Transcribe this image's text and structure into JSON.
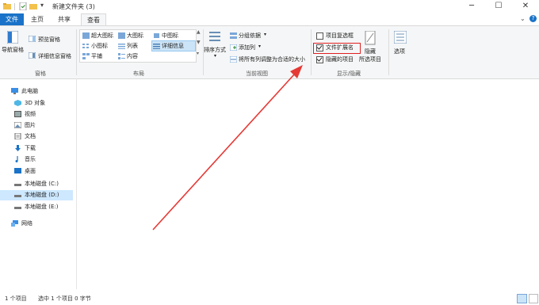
{
  "window": {
    "title": "新建文件夹 (3)",
    "controls": [
      "─",
      "☐",
      "✕"
    ]
  },
  "tabs": [
    {
      "label": "文件"
    },
    {
      "label": "主页"
    },
    {
      "label": "共享"
    },
    {
      "label": "查看"
    }
  ],
  "ribbon": {
    "panes": {
      "navigation_pane": "导航窗格",
      "preview_pane": "预览窗格",
      "details_pane": "详细信息窗格",
      "group_label": "窗格"
    },
    "layout": {
      "extra_large_icons": "超大图标",
      "large_icons": "大图标",
      "medium_icons": "中图标",
      "small_icons": "小图标",
      "list": "列表",
      "details": "详细信息",
      "tiles": "平铺",
      "content": "内容",
      "group_label": "布局"
    },
    "current_view": {
      "sort_by": "排序方式",
      "group_by": "分组依据",
      "add_columns": "添加列",
      "size_all_columns": "将所有列调整为合适的大小",
      "group_label": "当前视图"
    },
    "show_hide": {
      "item_checkboxes": "项目复选框",
      "item_checkboxes_checked": false,
      "file_extensions": "文件扩展名",
      "file_extensions_checked": true,
      "hidden_items": "隐藏的项目",
      "hidden_items_checked": true,
      "hide_selected": "隐藏",
      "hide_selected_line2": "所选项目",
      "group_label": "显示/隐藏"
    },
    "options": "选项"
  },
  "nav": {
    "items": [
      {
        "label": "此电脑",
        "icon": "computer-icon"
      },
      {
        "label": "3D 对象",
        "icon": "3d-objects-icon"
      },
      {
        "label": "视频",
        "icon": "video-icon"
      },
      {
        "label": "图片",
        "icon": "pictures-icon"
      },
      {
        "label": "文档",
        "icon": "documents-icon"
      },
      {
        "label": "下载",
        "icon": "downloads-icon"
      },
      {
        "label": "音乐",
        "icon": "music-icon"
      },
      {
        "label": "桌面",
        "icon": "desktop-icon"
      },
      {
        "label": "本地磁盘 (C:)",
        "icon": "drive-icon"
      },
      {
        "label": "本地磁盘 (D:)",
        "icon": "drive-icon"
      },
      {
        "label": "本地磁盘 (E:)",
        "icon": "drive-icon"
      },
      {
        "label": "网络",
        "icon": "network-icon"
      }
    ]
  },
  "status": {
    "item_count": "1 个项目",
    "selected": "选中 1 个项目 0 字节"
  },
  "colors": {
    "accent": "#1a73c8",
    "highlight_box": "#e02020",
    "arrow": "#e53935",
    "selection": "#cde8ff"
  }
}
